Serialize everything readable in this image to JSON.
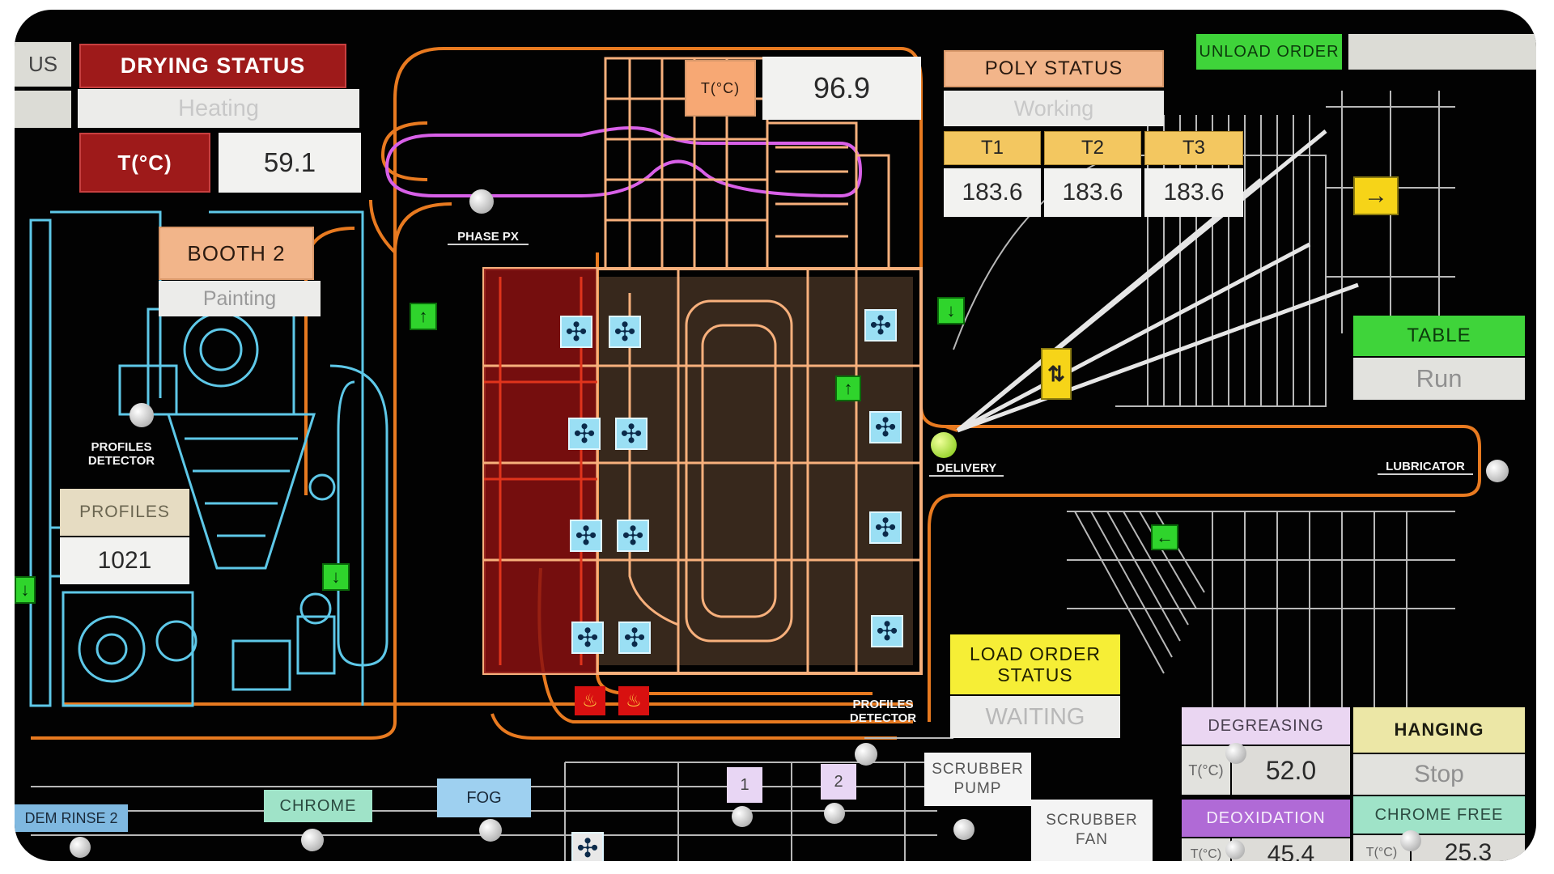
{
  "drying": {
    "partial": "US",
    "title": "DRYING STATUS",
    "state": "Heating",
    "temp_label": "T(°C)",
    "temp": "59.1"
  },
  "oven": {
    "temp_label": "T(°C)",
    "temp": "96.9"
  },
  "booth": {
    "title": "BOOTH 2",
    "state": "Painting"
  },
  "profiles": {
    "detector_label": "PROFILES\nDETECTOR",
    "title": "PROFILES",
    "count": "1021",
    "detector2_label": "PROFILES\nDETECTOR"
  },
  "tags": {
    "phase": "PHASE PX",
    "delivery": "DELIVERY",
    "lubricator": "LUBRICATOR"
  },
  "poly": {
    "title": "POLY STATUS",
    "state": "Working",
    "t1_label": "T1",
    "t2_label": "T2",
    "t3_label": "T3",
    "t1": "183.6",
    "t2": "183.6",
    "t3": "183.6"
  },
  "unload": {
    "button": "UNLOAD ORDER"
  },
  "table": {
    "title": "TABLE",
    "state": "Run"
  },
  "load": {
    "title": "LOAD ORDER STATUS",
    "state": "WAITING"
  },
  "degreasing": {
    "title": "DEGREASING",
    "temp_label": "T(°C)",
    "temp": "52.0"
  },
  "hanging": {
    "title": "HANGING",
    "state": "Stop"
  },
  "deoxidation": {
    "title": "DEOXIDATION",
    "temp_label": "T(°C)",
    "temp": "45.4"
  },
  "chrome_free": {
    "title": "CHROME FREE",
    "temp_label": "T(°C)",
    "temp": "25.3"
  },
  "bottom": {
    "rinse": "DEM RINSE 2",
    "chrome": "CHROME",
    "fog": "FOG",
    "stage1": "1",
    "stage2": "2",
    "scrubber_pump": "SCRUBBER PUMP",
    "scrubber_fan": "SCRUBBER FAN"
  },
  "icons": {
    "fan": "fan-icon",
    "flame": "flame-icon",
    "arrow_up": "arrow-up-icon",
    "arrow_down": "arrow-down-icon",
    "arrow_left": "arrow-left-icon",
    "arrow_right": "arrow-right-icon",
    "arrow_updown": "arrow-updown-icon"
  },
  "colors": {
    "background": "#020202",
    "orange_line": "#e87a20",
    "cyan_line": "#5ec8e8",
    "magenta_line": "#d860e8",
    "oven_fill": "#f7b07c",
    "oven_hot": "#b81c1c",
    "wire": "#b8b8b8",
    "green": "#2fd42c"
  }
}
